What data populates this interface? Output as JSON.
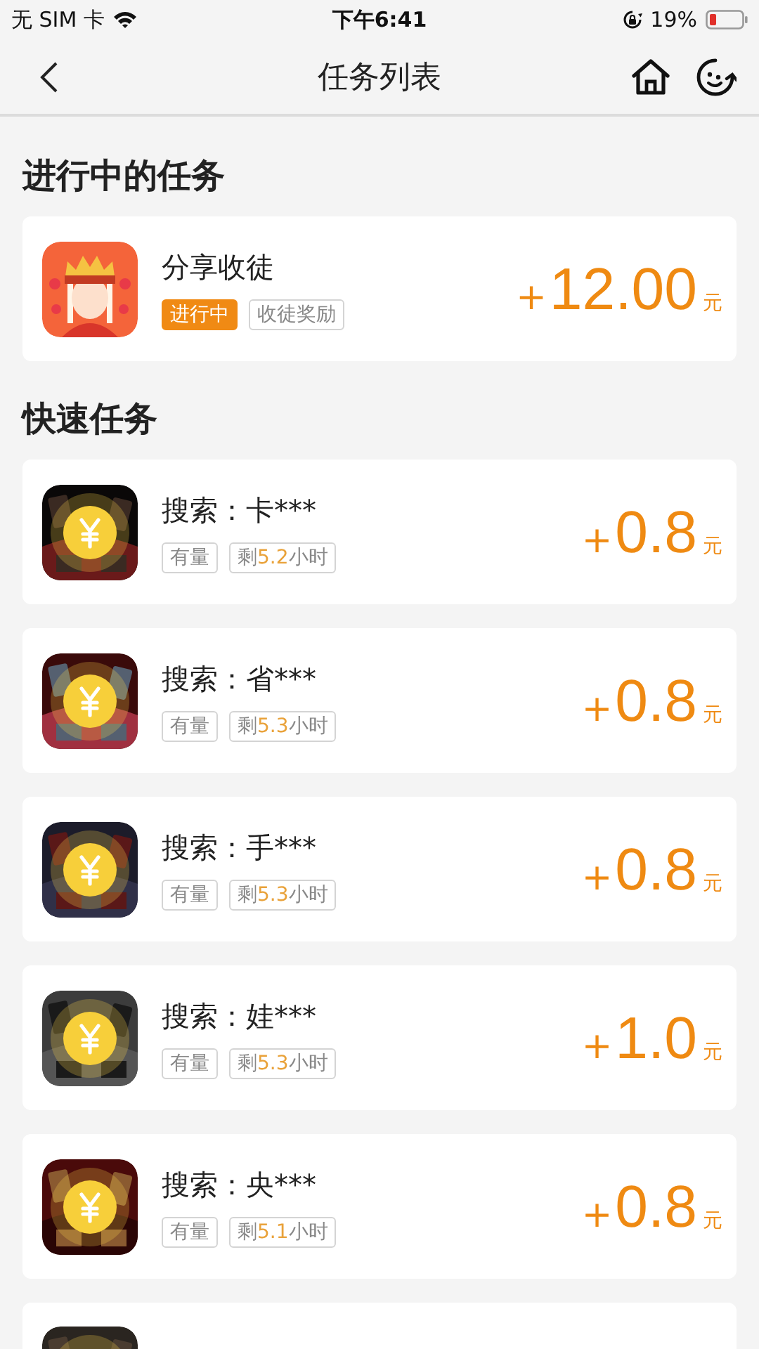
{
  "status_bar": {
    "carrier": "无 SIM 卡",
    "time": "下午6:41",
    "battery": "19%"
  },
  "nav": {
    "title": "任务列表"
  },
  "sections": [
    {
      "heading": "进行中的任务",
      "tasks": [
        {
          "coin": false,
          "title": "分享收徒",
          "tags": [
            {
              "kind": "status",
              "text": "进行中"
            },
            {
              "kind": "label",
              "text": "收徒奖励"
            }
          ],
          "sign": "+",
          "amount": "12.00",
          "unit": "元"
        }
      ]
    },
    {
      "heading": "快速任务",
      "tasks": [
        {
          "coin": true,
          "title": "搜索：卡***",
          "tags": [
            {
              "kind": "label",
              "text": "有量"
            },
            {
              "kind": "remaining",
              "prefix": "剩",
              "value": "5.2",
              "suffix": "小时"
            }
          ],
          "sign": "+",
          "amount": "0.8",
          "unit": "元"
        },
        {
          "coin": true,
          "title": "搜索：省***",
          "tags": [
            {
              "kind": "label",
              "text": "有量"
            },
            {
              "kind": "remaining",
              "prefix": "剩",
              "value": "5.3",
              "suffix": "小时"
            }
          ],
          "sign": "+",
          "amount": "0.8",
          "unit": "元"
        },
        {
          "coin": true,
          "title": "搜索：手***",
          "tags": [
            {
              "kind": "label",
              "text": "有量"
            },
            {
              "kind": "remaining",
              "prefix": "剩",
              "value": "5.3",
              "suffix": "小时"
            }
          ],
          "sign": "+",
          "amount": "0.8",
          "unit": "元"
        },
        {
          "coin": true,
          "title": "搜索：娃***",
          "tags": [
            {
              "kind": "label",
              "text": "有量"
            },
            {
              "kind": "remaining",
              "prefix": "剩",
              "value": "5.3",
              "suffix": "小时"
            }
          ],
          "sign": "+",
          "amount": "1.0",
          "unit": "元"
        },
        {
          "coin": true,
          "title": "搜索：央***",
          "tags": [
            {
              "kind": "label",
              "text": "有量"
            },
            {
              "kind": "remaining",
              "prefix": "剩",
              "value": "5.1",
              "suffix": "小时"
            }
          ],
          "sign": "+",
          "amount": "0.8",
          "unit": "元"
        },
        {
          "kind": "picture"
        }
      ]
    }
  ]
}
